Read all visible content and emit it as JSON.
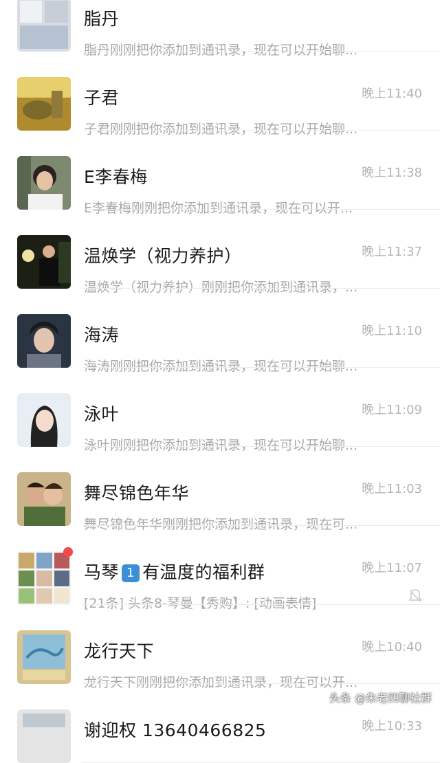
{
  "chats": [
    {
      "name": "脂丹",
      "preview": "脂丹刚刚把你添加到通讯录，现在可以开始聊...",
      "time": ""
    },
    {
      "name": "子君",
      "preview": "子君刚刚把你添加到通讯录，现在可以开始聊...",
      "time": "晚上11:40"
    },
    {
      "name": "E李春梅",
      "preview": "E李春梅刚刚把你添加到通讯录，现在可以开...",
      "time": "晚上11:38"
    },
    {
      "name": "温焕学（视力养护）",
      "preview": "温焕学（视力养护）刚刚把你添加到通讯录，...",
      "time": "晚上11:37"
    },
    {
      "name": "海涛",
      "preview": "海涛刚刚把你添加到通讯录，现在可以开始聊...",
      "time": "晚上11:10"
    },
    {
      "name": "泳叶",
      "preview": "泳叶刚刚把你添加到通讯录，现在可以开始聊...",
      "time": "晚上11:09"
    },
    {
      "name": "舞尽锦色年华",
      "preview": "舞尽锦色年华刚刚把你添加到通讯录，现在可...",
      "time": "晚上11:03"
    },
    {
      "name_a": "马琴",
      "name_badge": "1",
      "name_b": "有温度的福利群",
      "preview": "[21条] 头条8-琴曼【秀购】: [动画表情]",
      "time": "晚上11:07",
      "icon": "bell-mute-icon"
    },
    {
      "name": "龙行天下",
      "preview": "龙行天下刚刚把你添加到通讯录，现在可以开...",
      "time": "晚上10:40"
    },
    {
      "name": "谢迎权 13640466825",
      "preview": "",
      "time": "晚上10:33"
    }
  ],
  "watermark": "头条 @朱老四聊社群"
}
